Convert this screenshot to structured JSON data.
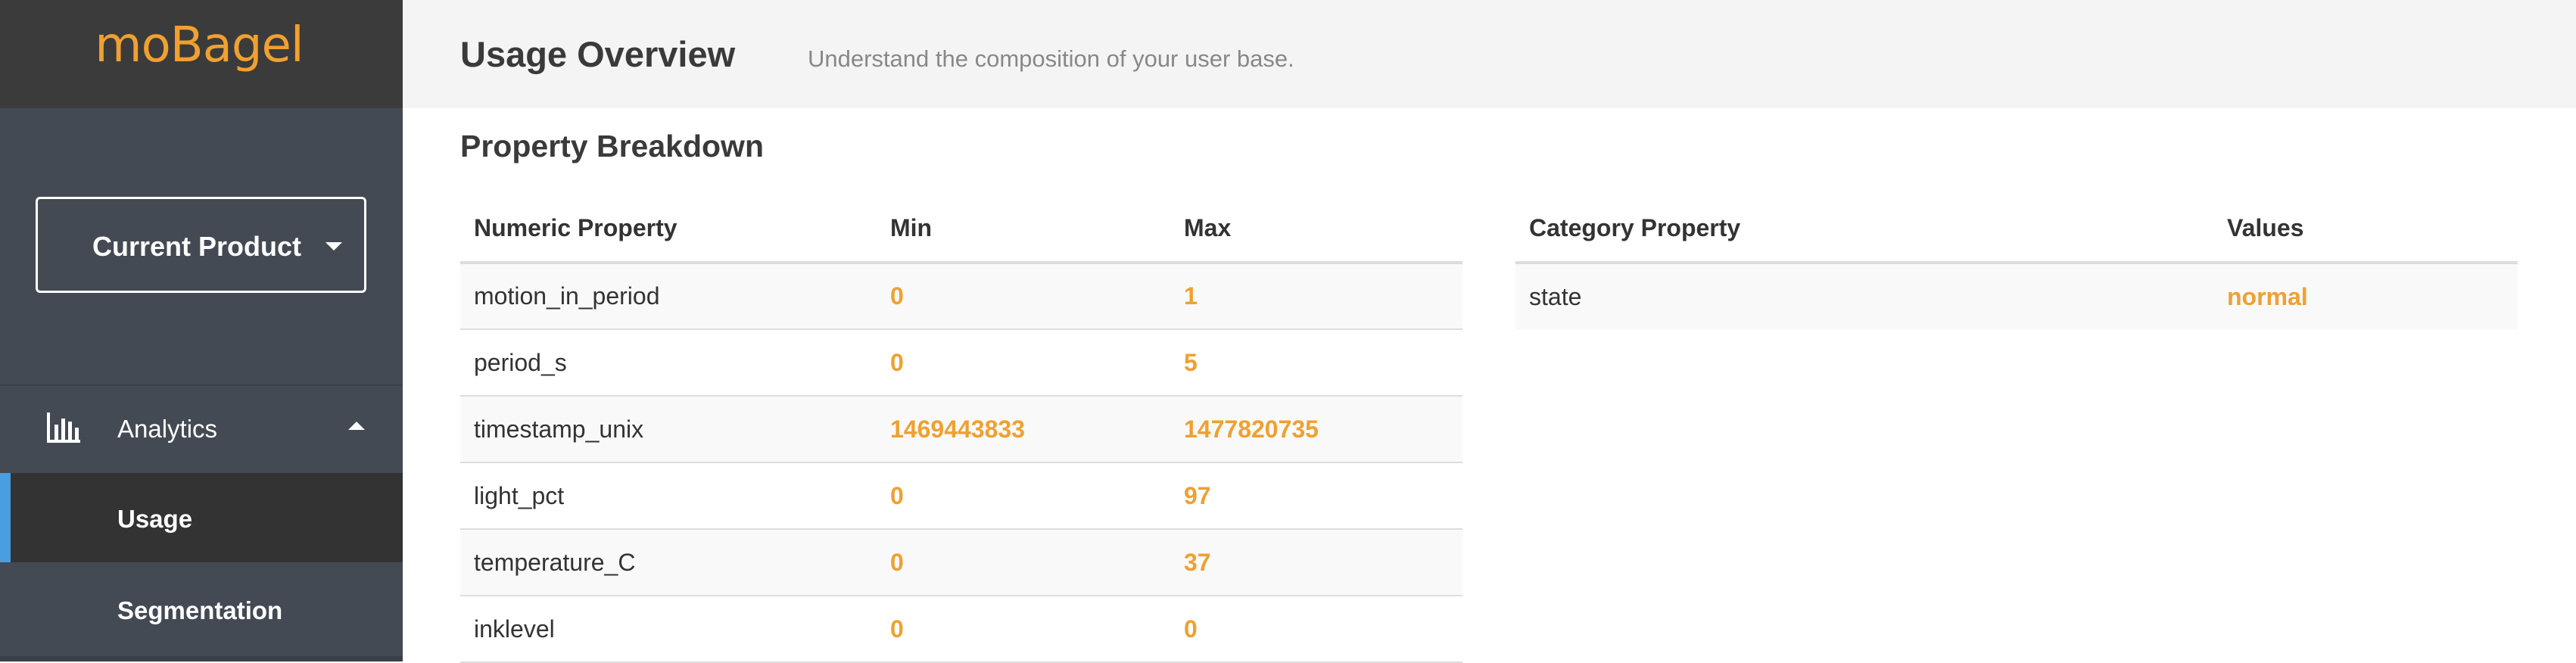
{
  "brand": {
    "logo": "moBagel",
    "logo_color": "#f0a030"
  },
  "sidebar": {
    "product_selector": "Current Product",
    "nav": {
      "analytics": "Analytics",
      "usage": "Usage",
      "segmentation": "Segmentation"
    },
    "active_item": "Usage",
    "accent_color": "#4a9de0"
  },
  "header": {
    "title": "Usage Overview",
    "subtitle": "Understand the composition of your user base."
  },
  "main": {
    "section_title": "Property Breakdown",
    "numeric_table": {
      "headers": [
        "Numeric Property",
        "Min",
        "Max"
      ],
      "rows": [
        {
          "name": "motion_in_period",
          "min": "0",
          "max": "1"
        },
        {
          "name": "period_s",
          "min": "0",
          "max": "5"
        },
        {
          "name": "timestamp_unix",
          "min": "1469443833",
          "max": "1477820735"
        },
        {
          "name": "light_pct",
          "min": "0",
          "max": "97"
        },
        {
          "name": "temperature_C",
          "min": "0",
          "max": "37"
        },
        {
          "name": "inklevel",
          "min": "0",
          "max": "0"
        }
      ]
    },
    "category_table": {
      "headers": [
        "Category Property",
        "Values"
      ],
      "rows": [
        {
          "name": "state",
          "value": "normal"
        }
      ]
    },
    "value_color": "#f0a030"
  }
}
